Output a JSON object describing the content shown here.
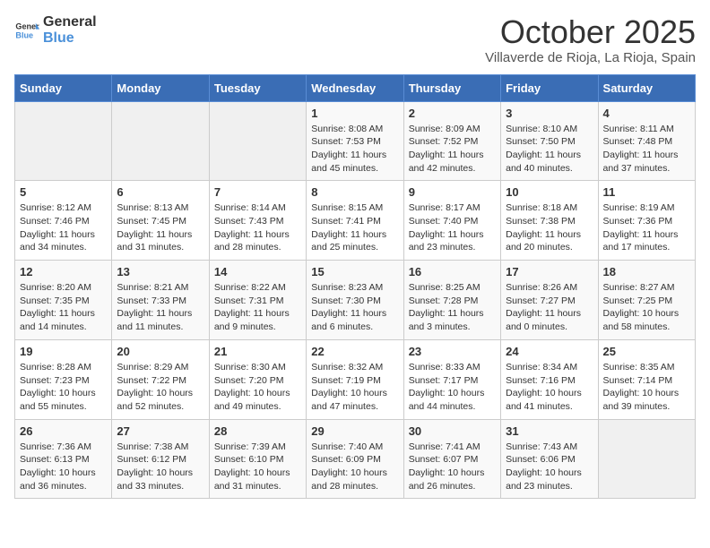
{
  "header": {
    "logo_line1": "General",
    "logo_line2": "Blue",
    "month": "October 2025",
    "location": "Villaverde de Rioja, La Rioja, Spain"
  },
  "weekdays": [
    "Sunday",
    "Monday",
    "Tuesday",
    "Wednesday",
    "Thursday",
    "Friday",
    "Saturday"
  ],
  "weeks": [
    [
      {
        "day": "",
        "sunrise": "",
        "sunset": "",
        "daylight": ""
      },
      {
        "day": "",
        "sunrise": "",
        "sunset": "",
        "daylight": ""
      },
      {
        "day": "",
        "sunrise": "",
        "sunset": "",
        "daylight": ""
      },
      {
        "day": "1",
        "sunrise": "8:08 AM",
        "sunset": "7:53 PM",
        "daylight": "11 hours and 45 minutes."
      },
      {
        "day": "2",
        "sunrise": "8:09 AM",
        "sunset": "7:52 PM",
        "daylight": "11 hours and 42 minutes."
      },
      {
        "day": "3",
        "sunrise": "8:10 AM",
        "sunset": "7:50 PM",
        "daylight": "11 hours and 40 minutes."
      },
      {
        "day": "4",
        "sunrise": "8:11 AM",
        "sunset": "7:48 PM",
        "daylight": "11 hours and 37 minutes."
      }
    ],
    [
      {
        "day": "5",
        "sunrise": "8:12 AM",
        "sunset": "7:46 PM",
        "daylight": "11 hours and 34 minutes."
      },
      {
        "day": "6",
        "sunrise": "8:13 AM",
        "sunset": "7:45 PM",
        "daylight": "11 hours and 31 minutes."
      },
      {
        "day": "7",
        "sunrise": "8:14 AM",
        "sunset": "7:43 PM",
        "daylight": "11 hours and 28 minutes."
      },
      {
        "day": "8",
        "sunrise": "8:15 AM",
        "sunset": "7:41 PM",
        "daylight": "11 hours and 25 minutes."
      },
      {
        "day": "9",
        "sunrise": "8:17 AM",
        "sunset": "7:40 PM",
        "daylight": "11 hours and 23 minutes."
      },
      {
        "day": "10",
        "sunrise": "8:18 AM",
        "sunset": "7:38 PM",
        "daylight": "11 hours and 20 minutes."
      },
      {
        "day": "11",
        "sunrise": "8:19 AM",
        "sunset": "7:36 PM",
        "daylight": "11 hours and 17 minutes."
      }
    ],
    [
      {
        "day": "12",
        "sunrise": "8:20 AM",
        "sunset": "7:35 PM",
        "daylight": "11 hours and 14 minutes."
      },
      {
        "day": "13",
        "sunrise": "8:21 AM",
        "sunset": "7:33 PM",
        "daylight": "11 hours and 11 minutes."
      },
      {
        "day": "14",
        "sunrise": "8:22 AM",
        "sunset": "7:31 PM",
        "daylight": "11 hours and 9 minutes."
      },
      {
        "day": "15",
        "sunrise": "8:23 AM",
        "sunset": "7:30 PM",
        "daylight": "11 hours and 6 minutes."
      },
      {
        "day": "16",
        "sunrise": "8:25 AM",
        "sunset": "7:28 PM",
        "daylight": "11 hours and 3 minutes."
      },
      {
        "day": "17",
        "sunrise": "8:26 AM",
        "sunset": "7:27 PM",
        "daylight": "11 hours and 0 minutes."
      },
      {
        "day": "18",
        "sunrise": "8:27 AM",
        "sunset": "7:25 PM",
        "daylight": "10 hours and 58 minutes."
      }
    ],
    [
      {
        "day": "19",
        "sunrise": "8:28 AM",
        "sunset": "7:23 PM",
        "daylight": "10 hours and 55 minutes."
      },
      {
        "day": "20",
        "sunrise": "8:29 AM",
        "sunset": "7:22 PM",
        "daylight": "10 hours and 52 minutes."
      },
      {
        "day": "21",
        "sunrise": "8:30 AM",
        "sunset": "7:20 PM",
        "daylight": "10 hours and 49 minutes."
      },
      {
        "day": "22",
        "sunrise": "8:32 AM",
        "sunset": "7:19 PM",
        "daylight": "10 hours and 47 minutes."
      },
      {
        "day": "23",
        "sunrise": "8:33 AM",
        "sunset": "7:17 PM",
        "daylight": "10 hours and 44 minutes."
      },
      {
        "day": "24",
        "sunrise": "8:34 AM",
        "sunset": "7:16 PM",
        "daylight": "10 hours and 41 minutes."
      },
      {
        "day": "25",
        "sunrise": "8:35 AM",
        "sunset": "7:14 PM",
        "daylight": "10 hours and 39 minutes."
      }
    ],
    [
      {
        "day": "26",
        "sunrise": "7:36 AM",
        "sunset": "6:13 PM",
        "daylight": "10 hours and 36 minutes."
      },
      {
        "day": "27",
        "sunrise": "7:38 AM",
        "sunset": "6:12 PM",
        "daylight": "10 hours and 33 minutes."
      },
      {
        "day": "28",
        "sunrise": "7:39 AM",
        "sunset": "6:10 PM",
        "daylight": "10 hours and 31 minutes."
      },
      {
        "day": "29",
        "sunrise": "7:40 AM",
        "sunset": "6:09 PM",
        "daylight": "10 hours and 28 minutes."
      },
      {
        "day": "30",
        "sunrise": "7:41 AM",
        "sunset": "6:07 PM",
        "daylight": "10 hours and 26 minutes."
      },
      {
        "day": "31",
        "sunrise": "7:43 AM",
        "sunset": "6:06 PM",
        "daylight": "10 hours and 23 minutes."
      },
      {
        "day": "",
        "sunrise": "",
        "sunset": "",
        "daylight": ""
      }
    ]
  ],
  "labels": {
    "sunrise": "Sunrise:",
    "sunset": "Sunset:",
    "daylight": "Daylight:"
  }
}
